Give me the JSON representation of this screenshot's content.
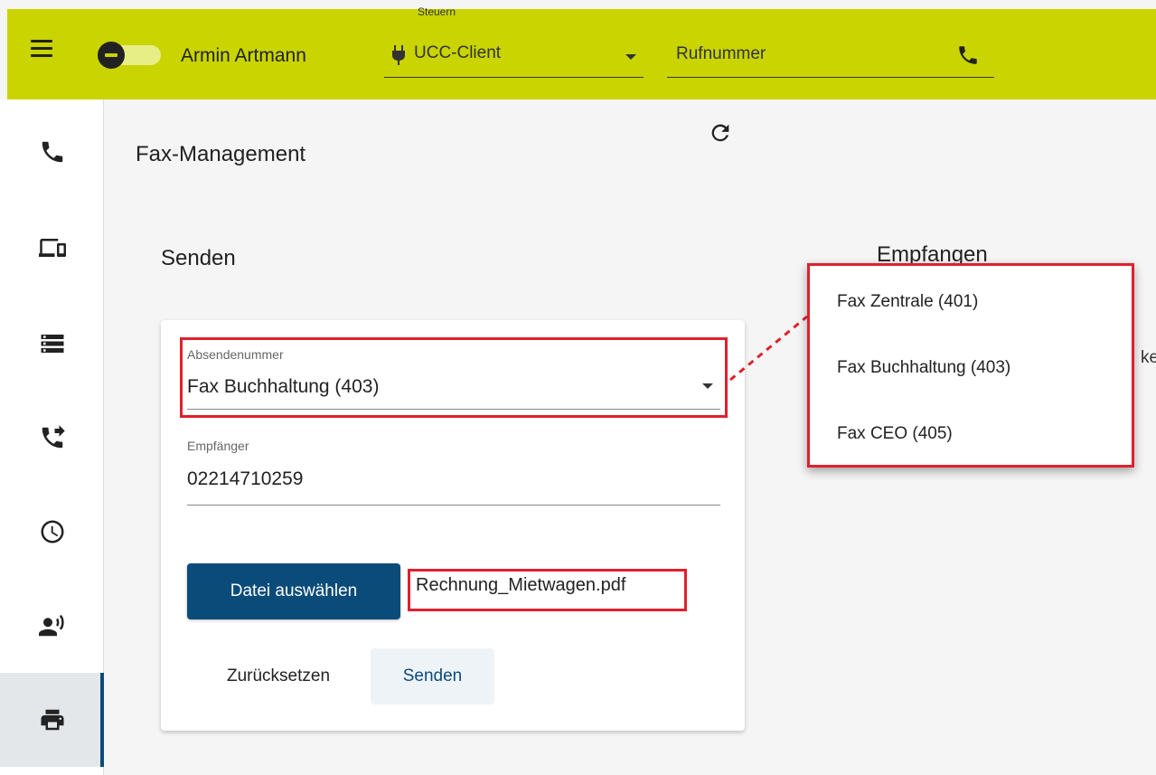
{
  "header": {
    "menu_icon": "hamburger-menu-icon",
    "status_toggle_icon": "toggle-icon",
    "user_name": "Armin Artmann",
    "control": {
      "label": "Steuern",
      "value": "UCC-Client",
      "icon": "plug-icon"
    },
    "phone": {
      "placeholder": "Rufnummer",
      "icon": "phone-icon"
    },
    "accent_color": "#c9d400"
  },
  "sidebar": {
    "items": [
      {
        "icon": "phone-icon",
        "active": false
      },
      {
        "icon": "devices-icon",
        "active": false
      },
      {
        "icon": "storage-icon",
        "active": false
      },
      {
        "icon": "call-forward-icon",
        "active": false
      },
      {
        "icon": "history-icon",
        "active": false
      },
      {
        "icon": "voicemail-speaker-icon",
        "active": false
      },
      {
        "icon": "printer-icon",
        "active": true
      }
    ]
  },
  "main": {
    "title": "Fax-Management",
    "refresh_icon": "refresh-icon",
    "send_title": "Senden",
    "receive_title": "Empfangen",
    "truncated_text": "ke",
    "form": {
      "sender_label": "Absendenummer",
      "sender_value": "Fax Buchhaltung (403)",
      "recipient_label": "Empfänger",
      "recipient_value": "02214710259",
      "choose_file_label": "Datei auswählen",
      "file_name": "Rechnung_Mietwagen.pdf",
      "reset_label": "Zurücksetzen",
      "send_label": "Senden"
    },
    "primary_color": "#0b4b7a",
    "highlight_color": "#e0202e"
  },
  "dropdown": {
    "options": [
      "Fax Zentrale (401)",
      "Fax Buchhaltung (403)",
      "Fax CEO (405)"
    ]
  }
}
